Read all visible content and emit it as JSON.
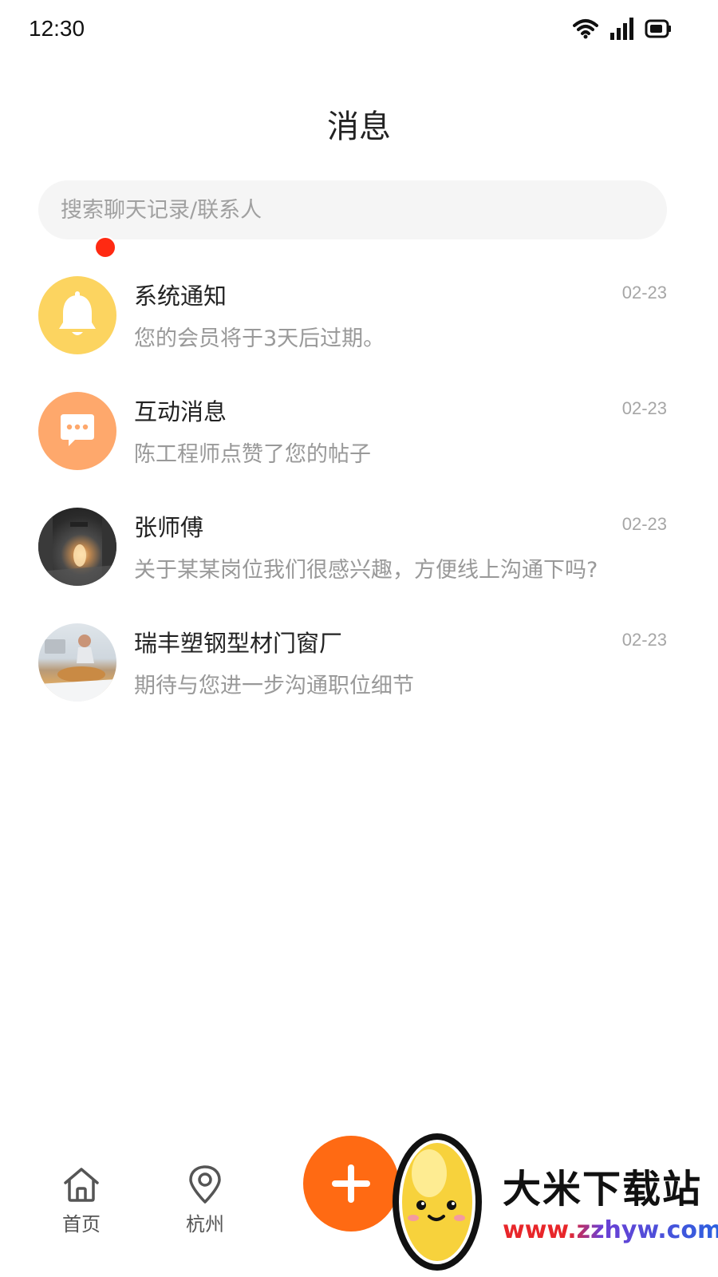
{
  "status_bar": {
    "time": "12:30"
  },
  "header": {
    "title": "消息"
  },
  "search": {
    "placeholder": "搜索聊天记录/联系人"
  },
  "conversations": [
    {
      "name": "系统通知",
      "date": "02-23",
      "preview": "您的会员将于3天后过期。",
      "avatar": "bell-icon",
      "avatar_color": "#fcd460"
    },
    {
      "name": "互动消息",
      "date": "02-23",
      "preview": "陈工程师点赞了您的帖子",
      "avatar": "chat-bubble-icon",
      "avatar_color": "#fea86c"
    },
    {
      "name": "张师傅",
      "date": "02-23",
      "preview": "关于某某岗位我们很感兴趣，方便线上沟通下吗?",
      "avatar": "photo",
      "unread": true
    },
    {
      "name": "瑞丰塑钢型材门窗厂",
      "date": "02-23",
      "preview": "期待与您进一步沟通职位细节",
      "avatar": "photo"
    }
  ],
  "tabbar": {
    "home_label": "首页",
    "city_label": "杭州",
    "add_icon": "plus-icon"
  },
  "watermark": {
    "title": "大米下载站",
    "url": "www.zzhyw.com"
  },
  "colors": {
    "accent": "#ff6a13",
    "badge": "#ff2a12",
    "muted_text": "#999999"
  }
}
